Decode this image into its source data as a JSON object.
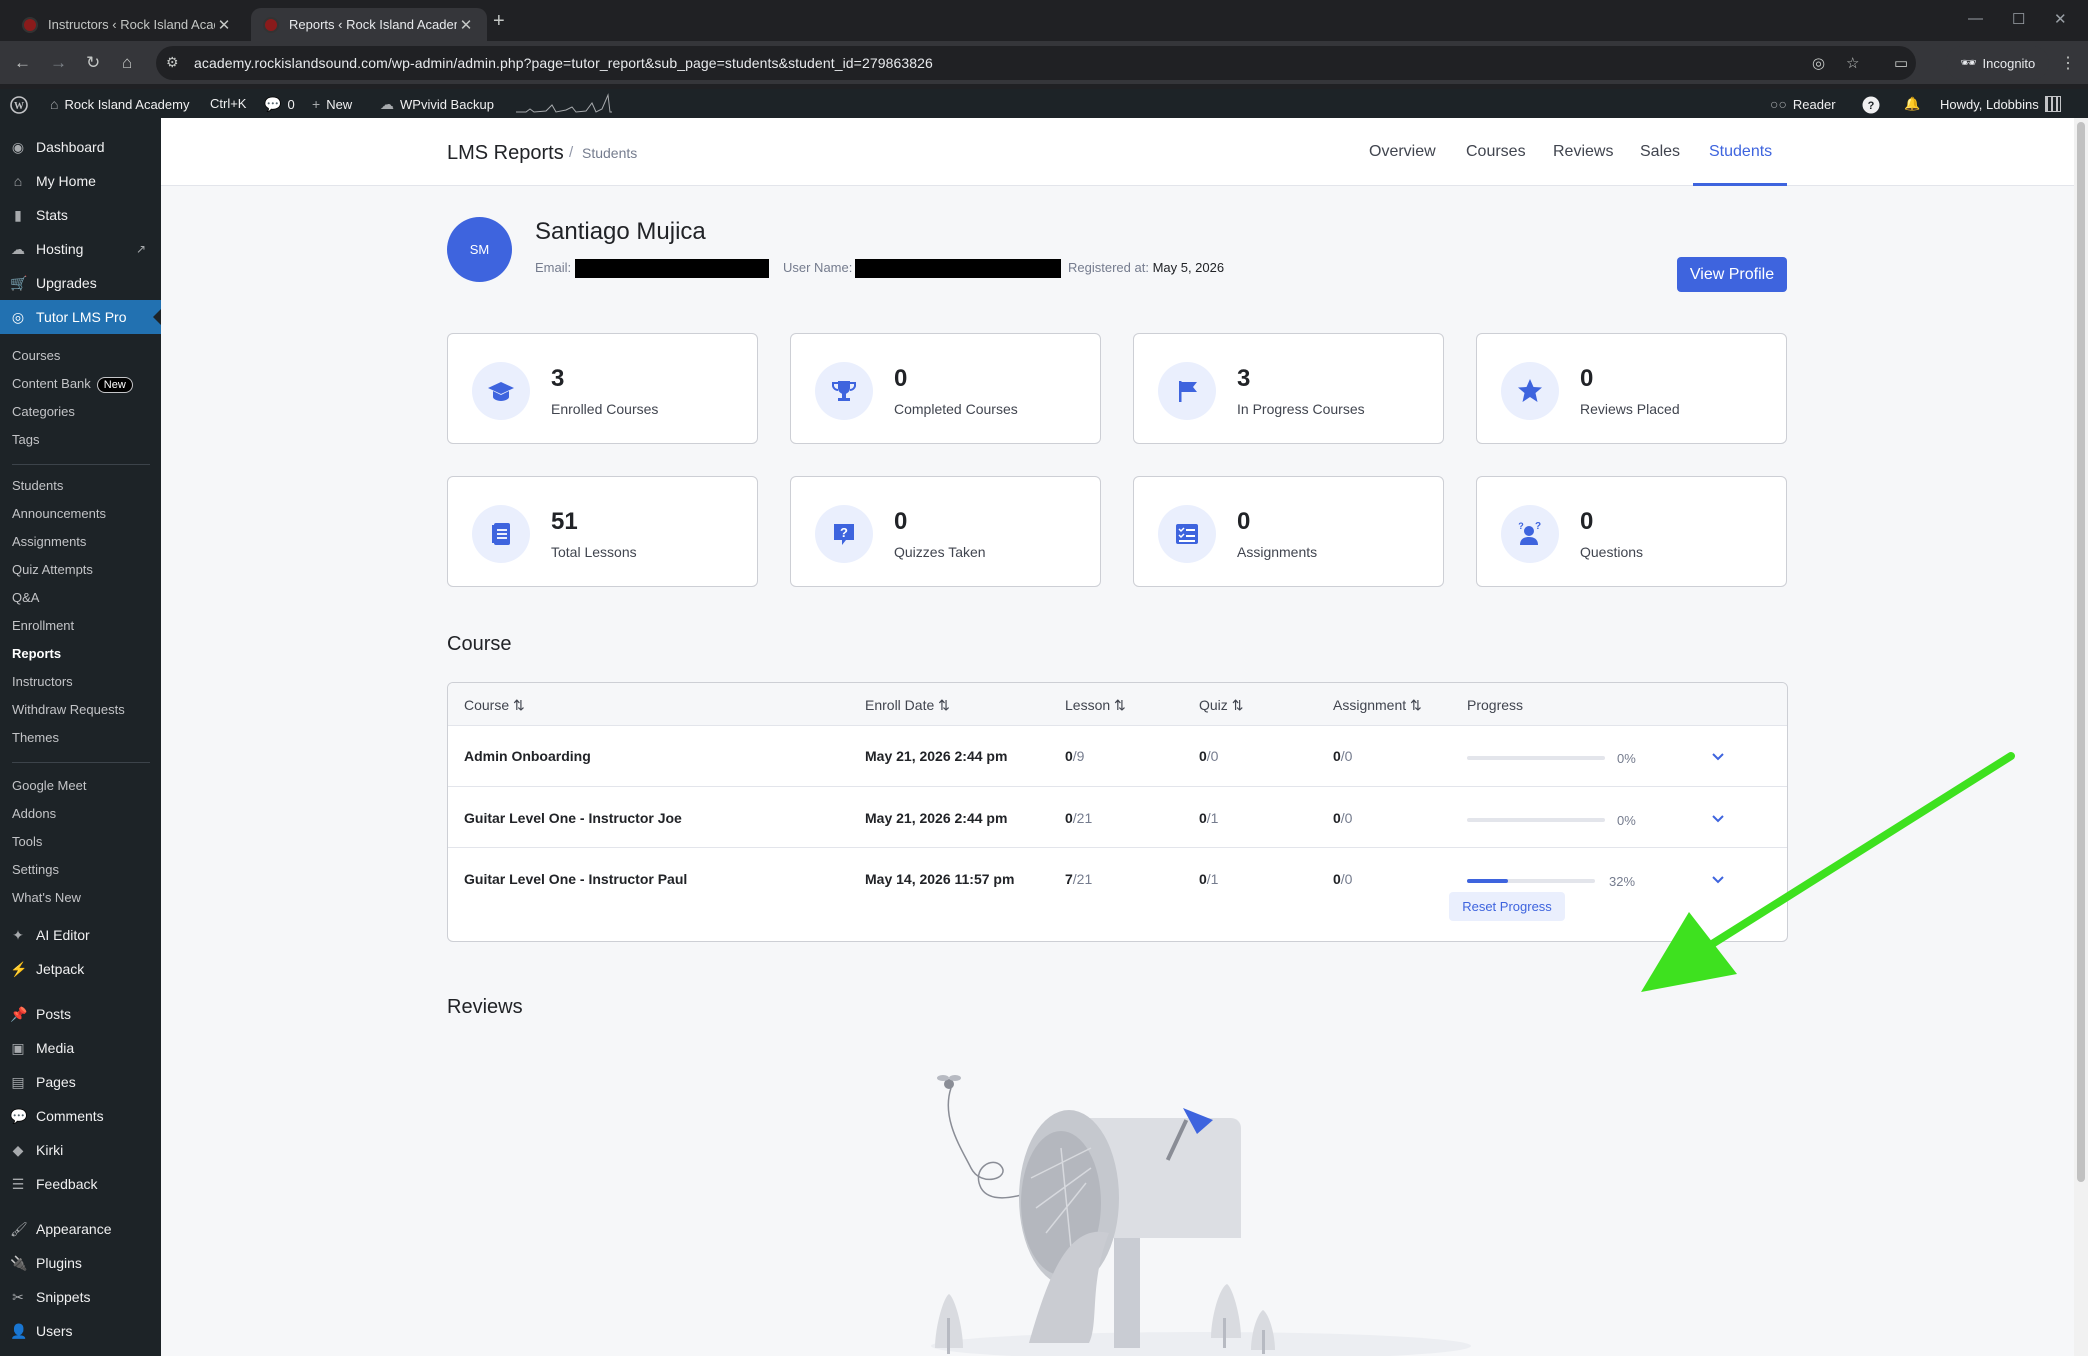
{
  "browser": {
    "tabs": [
      {
        "title": "Instructors ‹ Rock Island Acade"
      },
      {
        "title": "Reports ‹ Rock Island Academy"
      }
    ],
    "url": "academy.rockislandsound.com/wp-admin/admin.php?page=tutor_report&sub_page=students&student_id=279863826",
    "incognito_label": "Incognito"
  },
  "adminbar": {
    "site_name": "Rock Island Academy",
    "shortcut": "Ctrl+K",
    "comments_count": "0",
    "new_label": "New",
    "backup_label": "WPvivid Backup",
    "reader_label": "Reader",
    "greeting": "Howdy, Ldobbins"
  },
  "sidebar": {
    "top_items": [
      "Dashboard",
      "My Home",
      "Stats",
      "Hosting",
      "Upgrades",
      "Tutor LMS Pro"
    ],
    "sub_items_1": [
      "Courses",
      "Content Bank",
      "Categories",
      "Tags"
    ],
    "new_badge": "New",
    "sub_items_2": [
      "Students",
      "Announcements",
      "Assignments",
      "Quiz Attempts",
      "Q&A",
      "Enrollment",
      "Reports",
      "Instructors",
      "Withdraw Requests",
      "Themes"
    ],
    "sub_items_3": [
      "Google Meet",
      "Addons",
      "Tools",
      "Settings",
      "What's New"
    ],
    "bottom_items": [
      "AI Editor",
      "Jetpack",
      "Posts",
      "Media",
      "Pages",
      "Comments",
      "Kirki",
      "Feedback",
      "Appearance",
      "Plugins",
      "Snippets",
      "Users"
    ]
  },
  "page": {
    "title": "LMS Reports",
    "breadcrumb_current": "Students",
    "tabs": [
      "Overview",
      "Courses",
      "Reviews",
      "Sales",
      "Students"
    ],
    "active_tab": "Students"
  },
  "student": {
    "initials": "SM",
    "name": "Santiago Mujica",
    "email_label": "Email:",
    "username_label": "User Name:",
    "registered_label": "Registered at:",
    "registered_date": "May 5, 2026",
    "view_profile_label": "View Profile"
  },
  "stats": [
    {
      "value": "3",
      "label": "Enrolled Courses",
      "icon": "graduation-cap-icon"
    },
    {
      "value": "0",
      "label": "Completed Courses",
      "icon": "trophy-icon"
    },
    {
      "value": "3",
      "label": "In Progress Courses",
      "icon": "flag-icon"
    },
    {
      "value": "0",
      "label": "Reviews Placed",
      "icon": "star-icon"
    },
    {
      "value": "51",
      "label": "Total Lessons",
      "icon": "document-icon"
    },
    {
      "value": "0",
      "label": "Quizzes Taken",
      "icon": "question-icon"
    },
    {
      "value": "0",
      "label": "Assignments",
      "icon": "checklist-icon"
    },
    {
      "value": "0",
      "label": "Questions",
      "icon": "person-question-icon"
    }
  ],
  "course_section": {
    "title": "Course",
    "headers": [
      "Course",
      "Enroll Date",
      "Lesson",
      "Quiz",
      "Assignment",
      "Progress"
    ],
    "rows": [
      {
        "course": "Admin Onboarding",
        "enroll_date": "May 21, 2026 2:44 pm",
        "lesson_done": "0",
        "lesson_total": "/9",
        "quiz_done": "0",
        "quiz_total": "/0",
        "assign_done": "0",
        "assign_total": "/0",
        "progress": 0,
        "progress_label": "0%"
      },
      {
        "course": "Guitar Level One - Instructor Joe",
        "enroll_date": "May 21, 2026 2:44 pm",
        "lesson_done": "0",
        "lesson_total": "/21",
        "quiz_done": "0",
        "quiz_total": "/1",
        "assign_done": "0",
        "assign_total": "/0",
        "progress": 0,
        "progress_label": "0%"
      },
      {
        "course": "Guitar Level One - Instructor Paul",
        "enroll_date": "May 14, 2026 11:57 pm",
        "lesson_done": "7",
        "lesson_total": "/21",
        "quiz_done": "0",
        "quiz_total": "/1",
        "assign_done": "0",
        "assign_total": "/0",
        "progress": 32,
        "progress_label": "32%",
        "reset_label": "Reset Progress"
      }
    ]
  },
  "reviews_section": {
    "title": "Reviews"
  },
  "colors": {
    "accent": "#3e64de",
    "admin_bg": "#1d2327",
    "wp_active": "#2271b1",
    "annotation_arrow": "#3ee11f"
  }
}
